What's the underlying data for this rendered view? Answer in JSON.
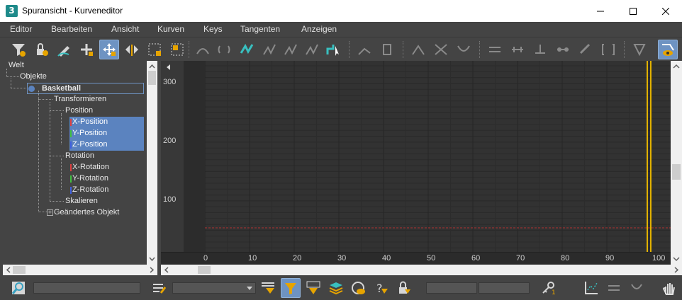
{
  "window": {
    "title": "Spuransicht - Kurveneditor",
    "app_icon_label": "3",
    "colors": {
      "accent": "#6e93c2",
      "selection": "#5b83bf",
      "keyline": "#e2b200",
      "redline": "#b03030"
    }
  },
  "menu": {
    "items": [
      {
        "label": "Editor"
      },
      {
        "label": "Bearbeiten"
      },
      {
        "label": "Ansicht"
      },
      {
        "label": "Kurven"
      },
      {
        "label": "Keys"
      },
      {
        "label": "Tangenten"
      },
      {
        "label": "Anzeigen"
      }
    ]
  },
  "toolbar": {
    "icons": [
      "filter-icon",
      "lock-selection-icon",
      "draw-curve-icon",
      "add-key-icon",
      "move-keys-icon",
      "slide-keys-icon",
      "scale-keys-icon",
      "scale-values-icon",
      "soft-select-icon",
      "loop-icon",
      "tangent-auto-icon",
      "tangent-spline-icon",
      "tangent-fast-icon",
      "tangent-slow-icon",
      "tangent-step-icon",
      "pointer-icon",
      "break-tangent-icon",
      "unify-tangent-icon",
      "lock-tangents-icon",
      "show-tangents-icon",
      "ease-curve-icon",
      "multiplier-curve-icon",
      "retime-icon",
      "region-tool-icon",
      "snap-frames-icon",
      "show-keyable-icon",
      "key-stats-icon",
      "zoom-extents-icon",
      "view-toggle-icon",
      "isolate-curve-icon"
    ]
  },
  "tree": {
    "nodes": [
      {
        "label": "Welt"
      },
      {
        "label": "Objekte"
      },
      {
        "label": "Basketball"
      },
      {
        "label": "Transformieren"
      },
      {
        "label": "Position"
      },
      {
        "label": "X-Position"
      },
      {
        "label": "Y-Position"
      },
      {
        "label": "Z-Position"
      },
      {
        "label": "Rotation"
      },
      {
        "label": "X-Rotation"
      },
      {
        "label": "Y-Rotation"
      },
      {
        "label": "Z-Rotation"
      },
      {
        "label": "Skalieren"
      },
      {
        "label": "Geändertes Objekt"
      }
    ]
  },
  "graph": {
    "y_ticks": [
      "300",
      "200",
      "100"
    ],
    "x_ticks": [
      "0",
      "10",
      "20",
      "30",
      "40",
      "50",
      "60",
      "70",
      "80",
      "90",
      "100"
    ]
  },
  "bottom": {
    "name_field_value": "",
    "dropdown_value": "",
    "frame_field_value": "",
    "value_field_value": ""
  }
}
